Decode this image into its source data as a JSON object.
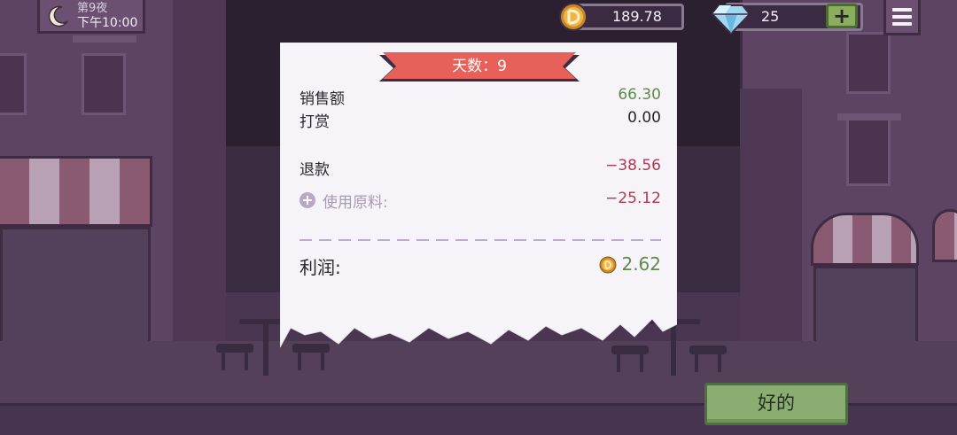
{
  "hud": {
    "night_label": "第9夜",
    "clock": "下午10:00",
    "coins": "189.78",
    "gems": "25",
    "gem_plus": "+",
    "icons": {
      "time": "moon-icon",
      "coins": "coin-icon",
      "gems": "diamond-icon",
      "menu": "hamburger-menu-icon"
    }
  },
  "receipt": {
    "title": "天数：9",
    "rows": {
      "sales": {
        "label": "销售额",
        "value": "66.30",
        "color": "#5e8a4a"
      },
      "tips": {
        "label": "打赏",
        "value": "0.00",
        "color": "#2a2430"
      },
      "refund": {
        "label": "退款",
        "value": "−38.56",
        "color": "#b03a4e"
      },
      "ingredients": {
        "label": "使用原料:",
        "value": "−25.12",
        "color": "#b03a4e",
        "expand": "+"
      }
    },
    "profit": {
      "label": "利润:",
      "value": "2.62",
      "color": "#5e8a4a"
    }
  },
  "ok_button": {
    "label": "好的"
  },
  "colors": {
    "ribbon": "#e8605a",
    "paper": "#f7f4f9",
    "button": "#8aae72",
    "background": "#4a3650"
  }
}
